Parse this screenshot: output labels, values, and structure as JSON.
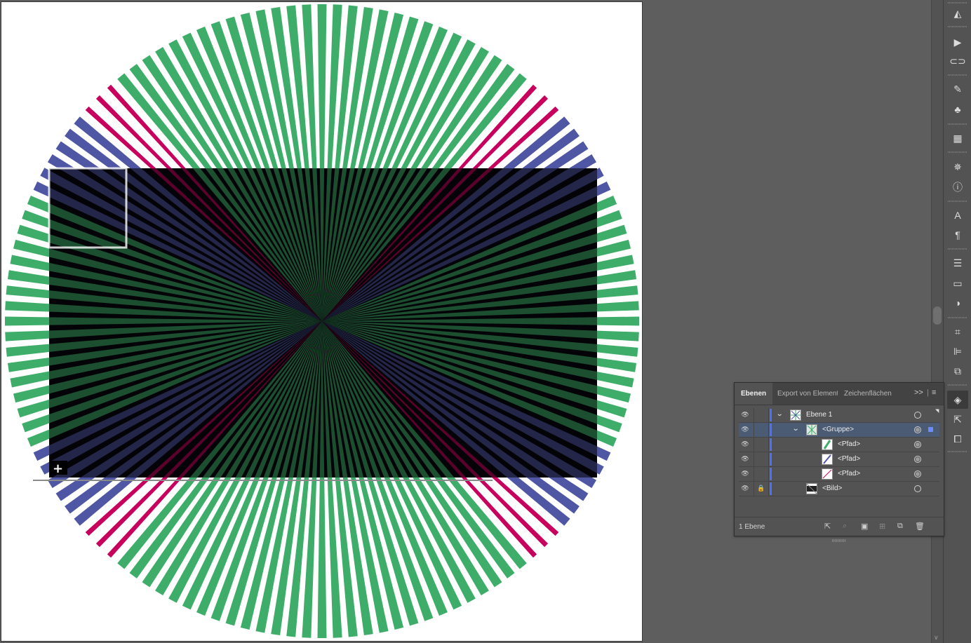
{
  "colors": {
    "ray_green": "#3fad6a",
    "ray_blue": "#4f56a3",
    "ray_magenta": "#c8005d",
    "rect_green": "#03562b",
    "rect_blue": "#1c1d55",
    "panel_bg": "#535353",
    "workspace_bg": "#5e5e5e",
    "selection": "#4a5b73",
    "layer_color": "#4f6fff"
  },
  "artwork": {
    "description_icon": "starburst-artwork",
    "add_cursor_icon": "plus-cursor-icon"
  },
  "toolstrip": {
    "icons": [
      "properties-icon",
      "play-icon",
      "links-icon",
      "brushes-icon",
      "symbols-icon",
      "swatches-icon",
      "appearance-icon",
      "info-icon",
      "character-styles-icon",
      "paragraph-styles-icon",
      "stroke-icon",
      "gradient-icon",
      "transparency-icon",
      "transform-icon",
      "align-icon",
      "pathfinder-icon",
      "layers-icon",
      "export-icon",
      "artboards-icon"
    ]
  },
  "layers_panel": {
    "tabs": {
      "layers": "Ebenen",
      "asset_export": "Export von Elementen",
      "artboards": "Zeichenflächen"
    },
    "controls": {
      "collapse": ">>",
      "menu": "≡"
    },
    "rows": [
      {
        "name": "Ebene 1",
        "visible": true,
        "locked": false,
        "expanded": true,
        "selected": false
      },
      {
        "name": "<Gruppe>",
        "visible": true,
        "locked": false,
        "expanded": true,
        "selected": true
      },
      {
        "name": "<Pfad>",
        "visible": true,
        "locked": false,
        "selected": false
      },
      {
        "name": "<Pfad>",
        "visible": true,
        "locked": false,
        "selected": false
      },
      {
        "name": "<Pfad>",
        "visible": true,
        "locked": false,
        "selected": false
      },
      {
        "name": "<Bild>",
        "visible": true,
        "locked": true,
        "selected": false
      }
    ],
    "footer": {
      "count": "1 Ebene",
      "icons": [
        "export-layer-icon",
        "locate-object-icon",
        "clipping-mask-icon",
        "new-sublayer-icon",
        "new-layer-icon",
        "delete-icon"
      ]
    }
  }
}
